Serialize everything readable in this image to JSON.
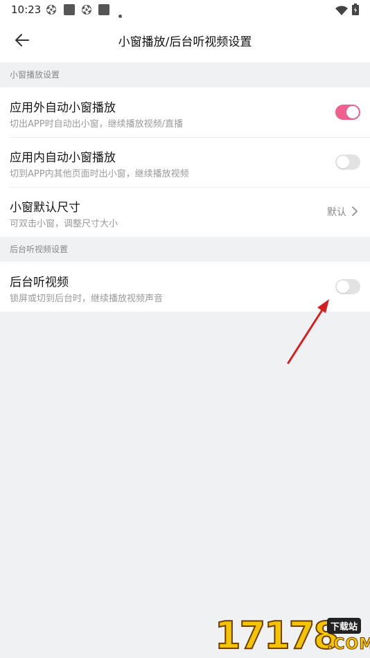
{
  "status_bar": {
    "time": "10:23"
  },
  "app_bar": {
    "title": "小窗播放/后台听视频设置"
  },
  "sections": [
    {
      "header": "小窗播放设置",
      "rows": [
        {
          "title": "应用外自动小窗播放",
          "subtitle": "切出APP时自动出小窗，继续播放视频/直播",
          "control": "toggle",
          "on": true
        },
        {
          "title": "应用内自动小窗播放",
          "subtitle": "切到APP内其他页面时出小窗，继续播放视频",
          "control": "toggle",
          "on": false
        },
        {
          "title": "小窗默认尺寸",
          "subtitle": "可双击小窗，调整尺寸大小",
          "control": "value",
          "value": "默认"
        }
      ]
    },
    {
      "header": "后台听视频设置",
      "rows": [
        {
          "title": "后台听视频",
          "subtitle": "锁屏或切到后台时，继续播放视频声音",
          "control": "toggle",
          "on": false
        }
      ]
    }
  ],
  "watermark": {
    "number": "17178",
    "badge": "下载站",
    "suffix": ".COM"
  },
  "colors": {
    "accent": "#f0608f",
    "toggle_off": "#e2e2e2",
    "annotation_arrow": "#d42020"
  }
}
